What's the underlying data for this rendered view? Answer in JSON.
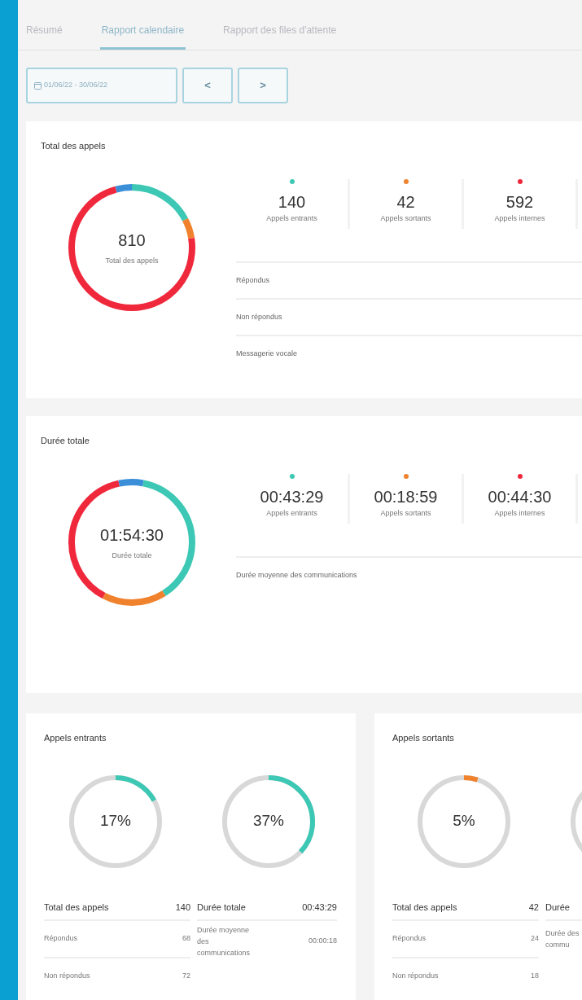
{
  "tabs": [
    {
      "label": "Résumé",
      "selected": false
    },
    {
      "label": "Rapport calendaire",
      "selected": true
    },
    {
      "label": "Rapport des files d'attente",
      "selected": false
    }
  ],
  "date_range": {
    "value": "01/06/22 - 30/06/22"
  },
  "nav_buttons": [
    "<",
    ">"
  ],
  "total_calls": {
    "title": "Total des appels",
    "donut": {
      "value": "810",
      "label": "Total des appels"
    },
    "stats": [
      {
        "value": "140",
        "label": "Appels entrants",
        "color": "#3cc8b4"
      },
      {
        "value": "42",
        "label": "Appels sortants",
        "color": "#f0822d"
      },
      {
        "value": "592",
        "label": "Appels internes",
        "color": "#f0283c"
      }
    ],
    "rows": [
      "Répondus",
      "Non répondus",
      "Messagerie vocale"
    ]
  },
  "total_duration": {
    "title": "Durée totale",
    "donut": {
      "value": "01:54:30",
      "label": "Durée totale"
    },
    "stats": [
      {
        "value": "00:43:29",
        "label": "Appels entrants",
        "color": "#3cc8b4"
      },
      {
        "value": "00:18:59",
        "label": "Appels sortants",
        "color": "#f0822d"
      },
      {
        "value": "00:44:30",
        "label": "Appels internes",
        "color": "#f0283c"
      }
    ],
    "rows": [
      "Durée moyenne des communications"
    ]
  },
  "breakdown_cards": [
    {
      "title": "Appels entrants",
      "color": "#3cc8b4",
      "rings": [
        {
          "kind": "ring",
          "percent": "17%",
          "level": 0.17
        },
        {
          "kind": "ring",
          "percent": "37%",
          "level": 0.37
        }
      ],
      "left_table": [
        {
          "label": "Total des appels",
          "value": "140"
        },
        {
          "label": "Répondus",
          "value": "68"
        },
        {
          "label": "Non répondus",
          "value": "72"
        }
      ],
      "right_table": [
        {
          "label": "Durée totale",
          "value": "00:43:29"
        },
        {
          "label": "Durée moyenne des communications",
          "value": "00:00:18"
        }
      ]
    },
    {
      "title": "Appels sortants",
      "color": "#f0822d",
      "rings": [
        {
          "kind": "ring",
          "percent": "5%",
          "level": 0.05
        },
        {
          "kind": "cut"
        }
      ],
      "left_table": [
        {
          "label": "Total des appels",
          "value": "42"
        },
        {
          "label": "Répondus",
          "value": "24"
        },
        {
          "label": "Non répondus",
          "value": "18"
        }
      ],
      "right_table": [
        {
          "label": "Durée"
        },
        {
          "label": "Durée des commu"
        }
      ]
    }
  ]
}
